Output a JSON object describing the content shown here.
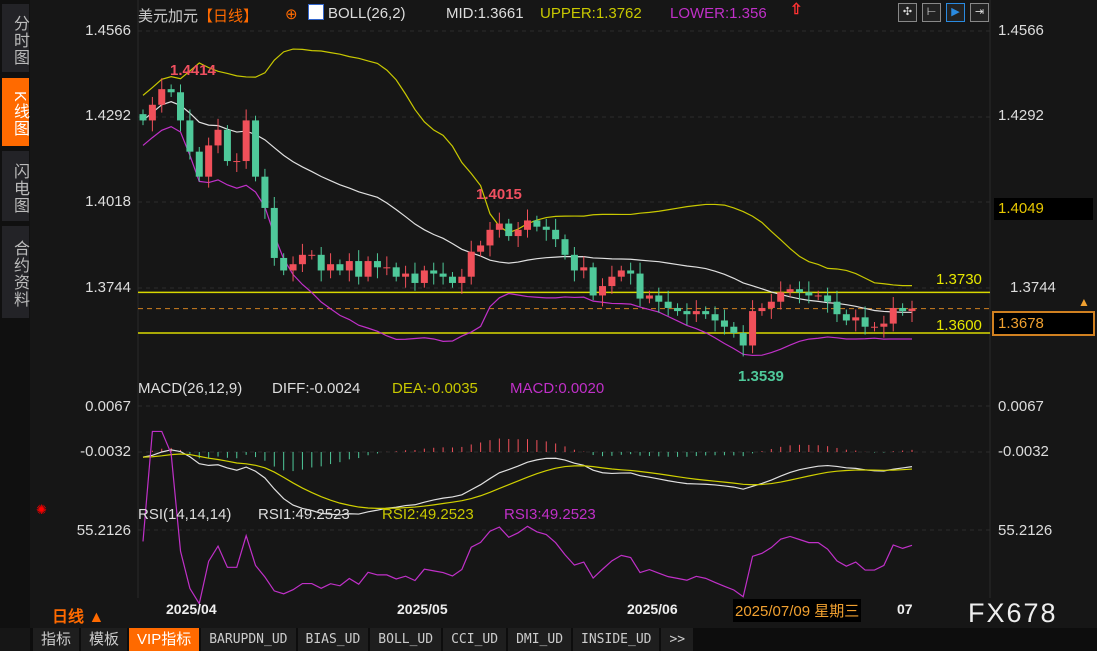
{
  "sidebar": {
    "items": [
      {
        "label": "分时图",
        "active": false
      },
      {
        "label": "K线图",
        "active": true
      },
      {
        "label": "闪电图",
        "active": false
      },
      {
        "label": "合约资料",
        "active": false
      }
    ]
  },
  "header": {
    "symbol": "美元加元",
    "period": "【日线】",
    "boll": "BOLL(26,2)",
    "mid": "MID:1.3661",
    "upper": "UPPER:1.3762",
    "lower": "LOWER:1.356"
  },
  "toolbar": [
    "crosshair-icon",
    "range-icon",
    "cursor-icon",
    "exit-icon"
  ],
  "price_axis": {
    "left": [
      "1.4566",
      "1.4292",
      "1.4018",
      "1.3744"
    ],
    "right": [
      "1.4566",
      "1.4292",
      "1.3744"
    ],
    "current": "1.3678",
    "level_1": "1.4049"
  },
  "levels": {
    "upper": "1.3730",
    "lower": "1.3600"
  },
  "annotations": {
    "high": "1.4414",
    "mid_high": "1.4015",
    "low": "1.3539"
  },
  "macd": {
    "title": "MACD(26,12,9)",
    "diff": "DIFF:-0.0024",
    "dea": "DEA:-0.0035",
    "macd": "MACD:0.0020",
    "axis": [
      "0.0067",
      "-0.0032"
    ]
  },
  "rsi": {
    "title": "RSI(14,14,14)",
    "rsi1": "RSI1:49.2523",
    "rsi2": "RSI2:49.2523",
    "rsi3": "RSI3:49.2523",
    "axis": [
      "55.2126"
    ]
  },
  "time_axis": {
    "period": "日线 ▲",
    "labels": [
      "2025/04",
      "2025/05",
      "2025/06"
    ],
    "cursor": "2025/07/09 星期三",
    "tail": "07"
  },
  "watermark": "FX678",
  "tabs": [
    {
      "label": "指标"
    },
    {
      "label": "模板"
    },
    {
      "label": "VIP指标",
      "active": true
    },
    {
      "label": "BARUPDN_UD"
    },
    {
      "label": "BIAS_UD"
    },
    {
      "label": "BOLL_UD"
    },
    {
      "label": "CCI_UD"
    },
    {
      "label": "DMI_UD"
    },
    {
      "label": "INSIDE_UD"
    },
    {
      "label": ">>"
    }
  ],
  "colors": {
    "up": "#f0505a",
    "down": "#4fc99a",
    "mid": "#e0e0e0",
    "upper": "#c8c800",
    "lower": "#c030c8",
    "accent": "#ff6a00"
  },
  "chart_data": {
    "type": "candlestick",
    "price_range": [
      1.348,
      1.46
    ],
    "closes": [
      1.428,
      1.433,
      1.438,
      1.437,
      1.428,
      1.418,
      1.41,
      1.42,
      1.425,
      1.415,
      1.415,
      1.428,
      1.41,
      1.4,
      1.384,
      1.38,
      1.382,
      1.385,
      1.385,
      1.38,
      1.382,
      1.38,
      1.383,
      1.378,
      1.383,
      1.381,
      1.381,
      1.378,
      1.379,
      1.376,
      1.38,
      1.379,
      1.378,
      1.376,
      1.378,
      1.386,
      1.388,
      1.393,
      1.395,
      1.391,
      1.393,
      1.396,
      1.394,
      1.393,
      1.39,
      1.385,
      1.38,
      1.381,
      1.372,
      1.375,
      1.378,
      1.38,
      1.379,
      1.371,
      1.372,
      1.37,
      1.368,
      1.367,
      1.366,
      1.367,
      1.366,
      1.364,
      1.362,
      1.36,
      1.356,
      1.367,
      1.368,
      1.37,
      1.373,
      1.374,
      1.373,
      1.372,
      1.372,
      1.37,
      1.366,
      1.364,
      1.365,
      1.362,
      1.362,
      1.363,
      1.368,
      1.367,
      1.3678
    ]
  }
}
